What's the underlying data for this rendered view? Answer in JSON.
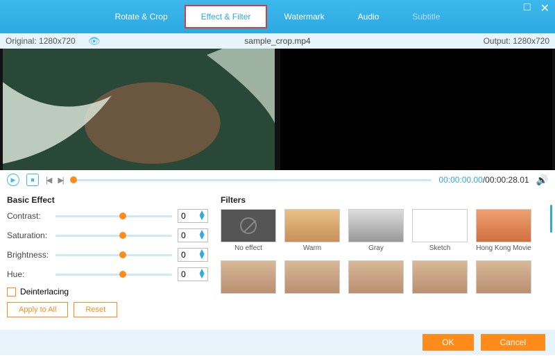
{
  "tabs": {
    "rotate": "Rotate & Crop",
    "effect": "Effect & Filter",
    "watermark": "Watermark",
    "audio": "Audio",
    "subtitle": "Subtitle"
  },
  "info": {
    "original": "Original: 1280x720",
    "filename": "sample_crop.mp4",
    "output": "Output: 1280x720"
  },
  "time": {
    "current": "00:00:00.00",
    "total": "/00:00:28.01"
  },
  "basic": {
    "heading": "Basic Effect",
    "contrast": {
      "label": "Contrast:",
      "value": "0"
    },
    "saturation": {
      "label": "Saturation:",
      "value": "0"
    },
    "brightness": {
      "label": "Brightness:",
      "value": "0"
    },
    "hue": {
      "label": "Hue:",
      "value": "0"
    },
    "deinterlacing": "Deinterlacing",
    "apply": "Apply to All",
    "reset": "Reset"
  },
  "filters": {
    "heading": "Filters",
    "items": [
      "No effect",
      "Warm",
      "Gray",
      "Sketch",
      "Hong Kong Movie",
      "",
      "",
      "",
      "",
      ""
    ]
  },
  "footer": {
    "ok": "OK",
    "cancel": "Cancel"
  }
}
